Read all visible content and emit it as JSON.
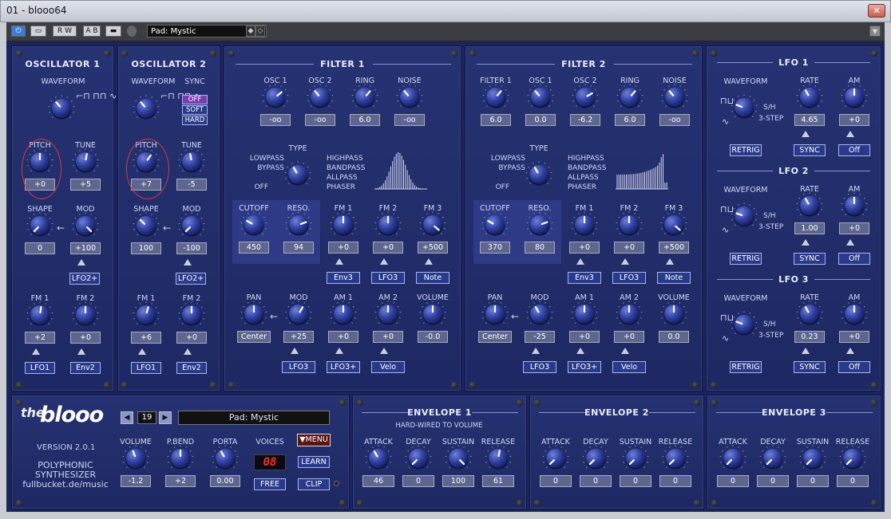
{
  "window": {
    "title": "01 - blooo64",
    "close": "✕"
  },
  "host": {
    "preset": "Pad: Mystic",
    "btn_rw": "R W",
    "btn_ab": "A B"
  },
  "osc1": {
    "title": "OSCILLATOR 1",
    "waveform": "WAVEFORM",
    "pitch": "PITCH",
    "pitch_val": "+0",
    "tune": "TUNE",
    "tune_val": "+5",
    "shape": "SHAPE",
    "shape_val": "0",
    "mod": "MOD",
    "mod_val": "+100",
    "mod_src": "LFO2+",
    "fm1": "FM 1",
    "fm1_val": "+2",
    "fm1_src": "LFO1",
    "fm2": "FM 2",
    "fm2_val": "+0",
    "fm2_src": "Env2"
  },
  "osc2": {
    "title": "OSCILLATOR 2",
    "waveform": "WAVEFORM",
    "sync": "SYNC",
    "sync_off": "OFF",
    "sync_soft": "SOFT",
    "sync_hard": "HARD",
    "pitch": "PITCH",
    "pitch_val": "+7",
    "tune": "TUNE",
    "tune_val": "-5",
    "shape": "SHAPE",
    "shape_val": "100",
    "mod": "MOD",
    "mod_val": "-100",
    "mod_src": "LFO2+",
    "fm1": "FM 1",
    "fm1_val": "+6",
    "fm1_src": "LFO1",
    "fm2": "FM 2",
    "fm2_val": "+0",
    "fm2_src": "Env2"
  },
  "filter1": {
    "title": "FILTER 1",
    "osc1": "OSC 1",
    "osc1_val": "-oo",
    "osc2": "OSC 2",
    "osc2_val": "-oo",
    "ring": "RING",
    "ring_val": "6.0",
    "noise": "NOISE",
    "noise_val": "-oo",
    "type": "TYPE",
    "t_lowpass": "LOWPASS",
    "t_bypass": "BYPASS",
    "t_off": "OFF",
    "t_highpass": "HIGHPASS",
    "t_bandpass": "BANDPASS",
    "t_allpass": "ALLPASS",
    "t_phaser": "PHASER",
    "cutoff": "CUTOFF",
    "cutoff_val": "450",
    "reso": "RESO.",
    "reso_val": "94",
    "fm1": "FM 1",
    "fm1_val": "+0",
    "fm1_src": "Env3",
    "fm2": "FM 2",
    "fm2_val": "+0",
    "fm2_src": "LFO3",
    "fm3": "FM 3",
    "fm3_val": "+500",
    "fm3_src": "Note",
    "pan": "PAN",
    "pan_val": "Center",
    "mod": "MOD",
    "mod_val": "+25",
    "mod_src": "LFO3",
    "am1": "AM 1",
    "am1_val": "+0",
    "am1_src": "LFO3+",
    "am2": "AM 2",
    "am2_val": "+0",
    "am2_src": "Velo",
    "volume": "VOLUME",
    "volume_val": "-0.0"
  },
  "filter2": {
    "title": "FILTER 2",
    "filter1": "FILTER 1",
    "filter1_val": "6.0",
    "osc1": "OSC 1",
    "osc1_val": "0.0",
    "osc2": "OSC 2",
    "osc2_val": "-6.2",
    "ring": "RING",
    "ring_val": "6.0",
    "noise": "NOISE",
    "noise_val": "-oo",
    "type": "TYPE",
    "t_lowpass": "LOWPASS",
    "t_bypass": "BYPASS",
    "t_off": "OFF",
    "t_highpass": "HIGHPASS",
    "t_bandpass": "BANDPASS",
    "t_allpass": "ALLPASS",
    "t_phaser": "PHASER",
    "cutoff": "CUTOFF",
    "cutoff_val": "370",
    "reso": "RESO.",
    "reso_val": "80",
    "fm1": "FM 1",
    "fm1_val": "+0",
    "fm1_src": "Env3",
    "fm2": "FM 2",
    "fm2_val": "+0",
    "fm2_src": "LFO3",
    "fm3": "FM 3",
    "fm3_val": "+500",
    "fm3_src": "Note",
    "pan": "PAN",
    "pan_val": "Center",
    "mod": "MOD",
    "mod_val": "-25",
    "mod_src": "LFO3",
    "am1": "AM 1",
    "am1_val": "+0",
    "am1_src": "LFO3+",
    "am2": "AM 2",
    "am2_val": "+0",
    "am2_src": "Velo",
    "volume": "VOLUME",
    "volume_val": "0.0"
  },
  "lfos": [
    {
      "title": "LFO 1",
      "waveform": "WAVEFORM",
      "sh": "S/H",
      "step": "3-STEP",
      "rate": "RATE",
      "rate_val": "4.65",
      "am": "AM",
      "am_val": "+0",
      "retrig": "RETRIG",
      "sync": "SYNC",
      "off": "Off"
    },
    {
      "title": "LFO 2",
      "waveform": "WAVEFORM",
      "sh": "S/H",
      "step": "3-STEP",
      "rate": "RATE",
      "rate_val": "1.00",
      "am": "AM",
      "am_val": "+0",
      "retrig": "RETRIG",
      "sync": "SYNC",
      "off": "Off"
    },
    {
      "title": "LFO 3",
      "waveform": "WAVEFORM",
      "sh": "S/H",
      "step": "3-STEP",
      "rate": "RATE",
      "rate_val": "0.23",
      "am": "AM",
      "am_val": "+0",
      "retrig": "RETRIG",
      "sync": "SYNC",
      "off": "Off"
    }
  ],
  "master": {
    "logo_the": "the",
    "logo_blooo": "blooo",
    "version": "VERSION 2.0.1",
    "desc1": "POLYPHONIC",
    "desc2": "SYNTHESIZER",
    "desc3": "fullbucket.de/music",
    "preset_num": "19",
    "preset_name": "Pad: Mystic",
    "volume": "VOLUME",
    "volume_val": "-1.2",
    "pbend": "P.BEND",
    "pbend_val": "+2",
    "porta": "PORTA",
    "porta_val": "0.00",
    "voices": "VOICES",
    "voices_val": "08",
    "menu": "▼MENU",
    "learn": "LEARN",
    "free": "FREE",
    "clip": "CLIP"
  },
  "envs": [
    {
      "title": "ENVELOPE 1",
      "note": "HARD-WIRED TO VOLUME",
      "attack": "ATTACK",
      "attack_val": "46",
      "decay": "DECAY",
      "decay_val": "0",
      "sustain": "SUSTAIN",
      "sustain_val": "100",
      "release": "RELEASE",
      "release_val": "61"
    },
    {
      "title": "ENVELOPE 2",
      "note": "",
      "attack": "ATTACK",
      "attack_val": "0",
      "decay": "DECAY",
      "decay_val": "0",
      "sustain": "SUSTAIN",
      "sustain_val": "0",
      "release": "RELEASE",
      "release_val": "0"
    },
    {
      "title": "ENVELOPE 3",
      "note": "",
      "attack": "ATTACK",
      "attack_val": "0",
      "decay": "DECAY",
      "decay_val": "0",
      "sustain": "SUSTAIN",
      "sustain_val": "0",
      "release": "RELEASE",
      "release_val": "0"
    }
  ],
  "colors": {
    "panel": "#263272",
    "accent": "#d23a4a",
    "display_red": "#ff3018"
  }
}
